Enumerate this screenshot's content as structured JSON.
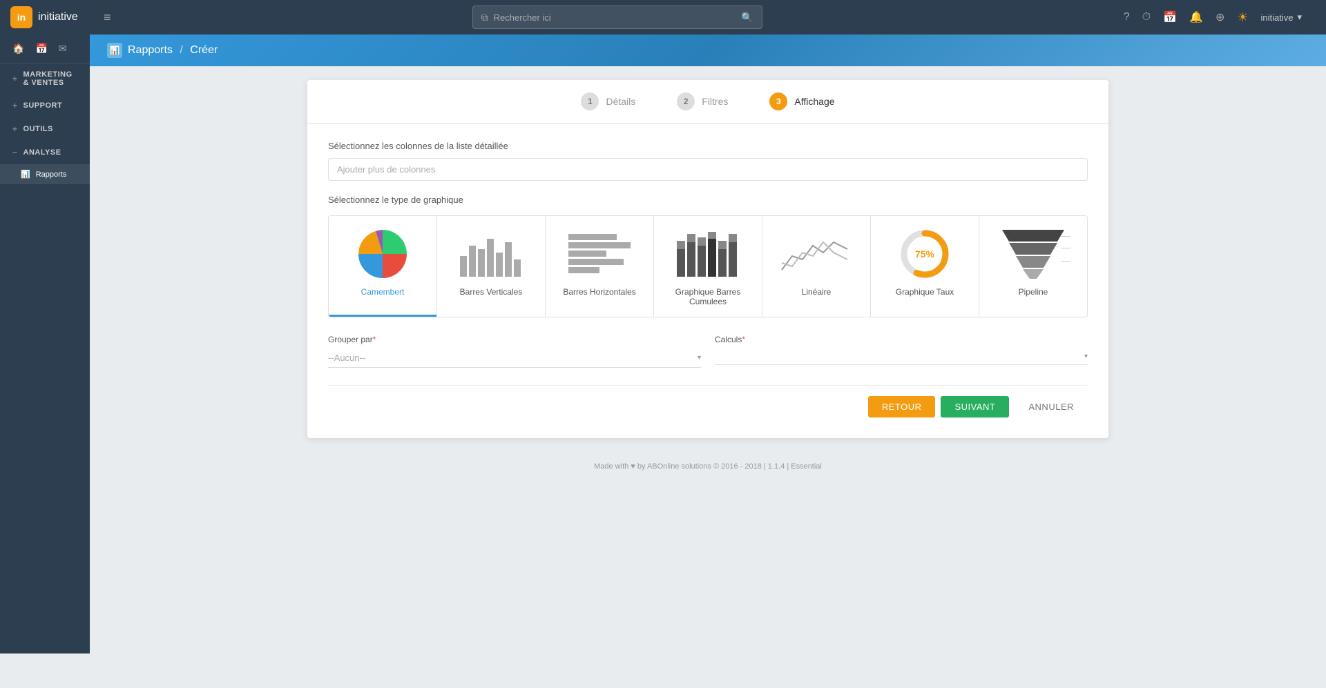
{
  "app": {
    "name": "initiative",
    "logo_letter": "in"
  },
  "navbar": {
    "hamburger_icon": "≡",
    "search_placeholder": "Rechercher ici",
    "icons": [
      "?",
      "⏱",
      "📅",
      "🔔",
      "⊕"
    ],
    "user_icon": "☀",
    "username": "initiative",
    "username_arrow": "▾"
  },
  "sidebar": {
    "icons": [
      "🏠",
      "📅",
      "✉"
    ],
    "items": [
      {
        "id": "marketing",
        "label": "Marketing & Ventes",
        "icon": "+",
        "has_sub": true
      },
      {
        "id": "support",
        "label": "Support",
        "icon": "+",
        "has_sub": true
      },
      {
        "id": "outils",
        "label": "Outils",
        "icon": "+",
        "has_sub": true
      },
      {
        "id": "analyse",
        "label": "Analyse",
        "icon": "−",
        "has_sub": true,
        "expanded": true
      },
      {
        "id": "rapports",
        "label": "Rapports",
        "icon": "📊",
        "is_sub": true,
        "active": true
      }
    ]
  },
  "page_header": {
    "icon": "📊",
    "breadcrumb_parent": "Rapports",
    "separator": "/",
    "breadcrumb_current": "Créer"
  },
  "stepper": {
    "steps": [
      {
        "id": "details",
        "num": "1",
        "label": "Détails",
        "state": "completed"
      },
      {
        "id": "filtres",
        "num": "2",
        "label": "Filtres",
        "state": "completed"
      },
      {
        "id": "affichage",
        "num": "3",
        "label": "Affichage",
        "state": "active"
      }
    ]
  },
  "form": {
    "columns_label": "Sélectionnez les colonnes de la liste détaillée",
    "columns_placeholder": "Ajouter plus de colonnes",
    "chart_type_label": "Sélectionnez le type de graphique",
    "chart_types": [
      {
        "id": "camembert",
        "name": "Camembert",
        "active": true
      },
      {
        "id": "barres_verticales",
        "name": "Barres Verticales",
        "active": false
      },
      {
        "id": "barres_horizontales",
        "name": "Barres Horizontales",
        "active": false
      },
      {
        "id": "graphique_barres_cumulees",
        "name": "Graphique Barres Cumulees",
        "active": false
      },
      {
        "id": "lineaire",
        "name": "Linéaire",
        "active": false
      },
      {
        "id": "graphique_taux",
        "name": "Graphique Taux",
        "active": false
      },
      {
        "id": "pipeline",
        "name": "Pipeline",
        "active": false
      }
    ],
    "group_by_label": "Grouper par",
    "group_by_required": "*",
    "group_by_value": "--Aucun--",
    "calculs_label": "Calculs",
    "calculs_required": "*",
    "calculs_value": "",
    "buttons": {
      "back": "RETOUR",
      "next": "SUIVANT",
      "cancel": "ANNULER"
    }
  },
  "footer": {
    "text": "Made with ♥ by ABOnline solutions © 2016 - 2018 | 1.1.4 | Essential"
  }
}
